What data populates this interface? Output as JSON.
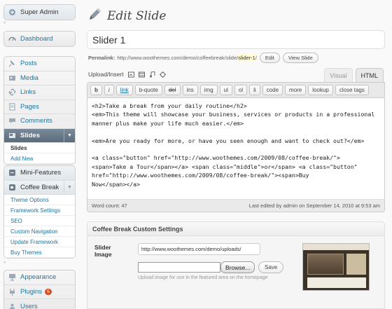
{
  "sidebar": {
    "top": [
      {
        "label": "Super Admin",
        "icon": "super-admin-icon"
      }
    ],
    "dashboard": [
      {
        "label": "Dashboard",
        "icon": "dashboard-icon"
      }
    ],
    "content": [
      {
        "label": "Posts",
        "icon": "pin-icon"
      },
      {
        "label": "Media",
        "icon": "media-icon"
      },
      {
        "label": "Links",
        "icon": "link-icon"
      },
      {
        "label": "Pages",
        "icon": "page-icon"
      },
      {
        "label": "Comments",
        "icon": "comment-icon"
      },
      {
        "label": "Slides",
        "icon": "slides-icon"
      }
    ],
    "slides_sub": [
      "Slides",
      "Add New"
    ],
    "features": [
      {
        "label": "Mini-Features",
        "icon": "features-icon"
      }
    ],
    "coffee": {
      "label": "Coffee Break",
      "icon": "coffee-icon"
    },
    "coffee_sub": [
      "Theme Options",
      "Framework Settings",
      "SEO",
      "Custom Navigation",
      "Update Framework",
      "Buy Themes"
    ],
    "bottom": [
      {
        "label": "Appearance",
        "icon": "appearance-icon"
      },
      {
        "label": "Plugins",
        "icon": "plugin-icon",
        "badge": "6"
      },
      {
        "label": "Users",
        "icon": "users-icon"
      }
    ]
  },
  "header": {
    "title": "Edit Slide",
    "icon": "pen-icon"
  },
  "post": {
    "title": "Slider 1",
    "permalink_label": "Permalink:",
    "permalink_base": "http://www.woothemes.com/demo/coffeebreak/slide/",
    "permalink_slug": "slider-1",
    "permalink_tail": "/",
    "edit_button": "Edit",
    "view_button": "View Slide"
  },
  "editor": {
    "upload_label": "Upload/Insert",
    "tabs": {
      "visual": "Visual",
      "html": "HTML"
    },
    "quicktags": [
      "b",
      "i",
      "link",
      "b-quote",
      "del",
      "ins",
      "img",
      "ul",
      "ol",
      "li",
      "code",
      "more",
      "lookup",
      "close tags"
    ],
    "content": "<h2>Take a break from your daily routine</h2>\n<em>This theme will showcase your business, services or products in a professional\nmanner plus make your life much easier.</em>\n\n<em>Are you ready for more, or have you seen enough and want to check out?</em>\n\n<a class=\"button\" href=\"http://www.woothemes.com/2009/08/coffee-break/\">\n<span>Take a Tour</span></a> <span class=\"middle\">or</span> <a class=\"button\"\nhref=\"http://www.woothemes.com/2009/08/coffee-break/\"><span>Buy\nNow</span></a>",
    "word_count": "Word count: 47",
    "last_edited": "Last edited by admin on September 14, 2010 at 9:53 am"
  },
  "custom_settings": {
    "title": "Coffee Break Custom Settings",
    "slider_label": "Slider Image",
    "slider_url": "http://www.woothemes.com/demo/uploads/",
    "browse_label": "Browse...",
    "save_label": "Save",
    "help": "Upload image for use in the featured area on the homepage"
  },
  "colors": {
    "link": "#21759b",
    "active_menu": "#6b7b89",
    "badge": "#d54e21"
  }
}
